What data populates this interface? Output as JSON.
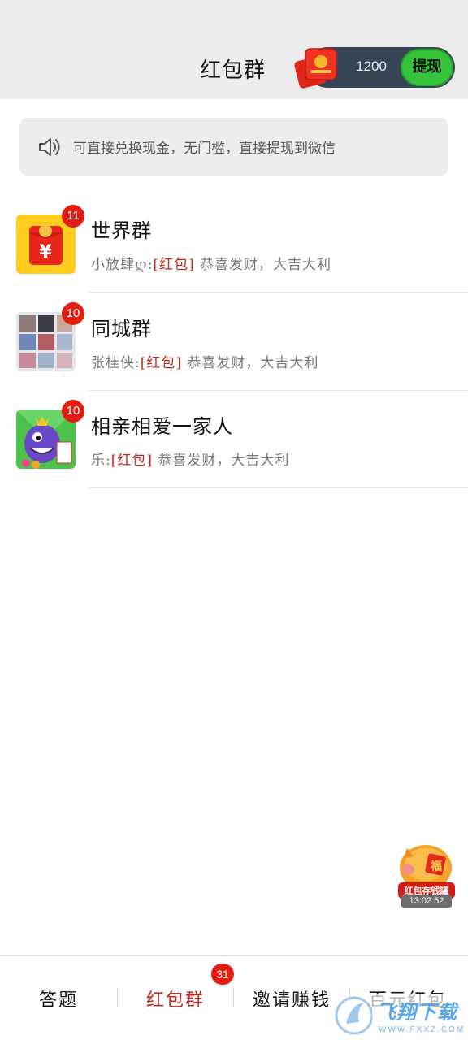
{
  "header": {
    "title": "红包群",
    "balance": "1200",
    "withdraw_label": "提现"
  },
  "notice": {
    "text": "可直接兑换现金，无门槛，直接提现到微信",
    "icon": "speaker-icon"
  },
  "chats": [
    {
      "name": "世界群",
      "unread": "11",
      "sender": "小放肆ღ:",
      "tag": "[红包]",
      "message": " 恭喜发财，大吉大利",
      "avatar": "red-envelope-avatar"
    },
    {
      "name": "同城群",
      "unread": "10",
      "sender": "张桂侠:",
      "tag": "[红包]",
      "message": " 恭喜发财，大吉大利",
      "avatar": "photo-grid-avatar"
    },
    {
      "name": "相亲相爱一家人",
      "unread": "10",
      "sender": "乐:",
      "tag": "[红包]",
      "message": " 恭喜发财，大吉大利",
      "avatar": "cartoon-monster-avatar"
    }
  ],
  "piggy_bank": {
    "label": "红包存钱罐",
    "timer": "13:02:52"
  },
  "tabs": [
    {
      "label": "答题",
      "active": false
    },
    {
      "label": "红包群",
      "active": true,
      "badge": "31"
    },
    {
      "label": "邀请赚钱",
      "active": false
    },
    {
      "label": "百元红包",
      "active": false
    }
  ],
  "watermark": {
    "text": "飞翔下载",
    "url": "WWW.FXXZ.COM"
  },
  "colors": {
    "accent_red": "#c0281c",
    "badge_red": "#e21d12",
    "withdraw_green": "#35c33b",
    "balance_bg": "#374556"
  }
}
